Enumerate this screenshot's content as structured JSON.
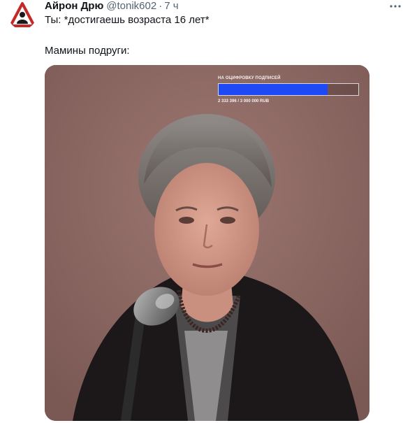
{
  "tweet": {
    "author_name": "Айрон Дрю",
    "author_handle": "@tonik602",
    "separator": "·",
    "time": "7 ч",
    "line1": "Ты: *достигаешь возраста 16 лет*",
    "line2": "Мамины подруги:"
  },
  "media": {
    "overlay_title": "НА ОЦИФРОВКУ ПОДПИСЕЙ",
    "progress_fraction": 0.78,
    "progress_color": "#1f49f5",
    "overlay_count": "2 333 396 / 3 000 000 RUB"
  },
  "colors": {
    "text": "#0f1419",
    "secondary": "#536471",
    "media_bg": "#8a6863"
  },
  "icons": {
    "avatar": "warning-sign-avatar-icon",
    "more": "more-dots-icon"
  }
}
